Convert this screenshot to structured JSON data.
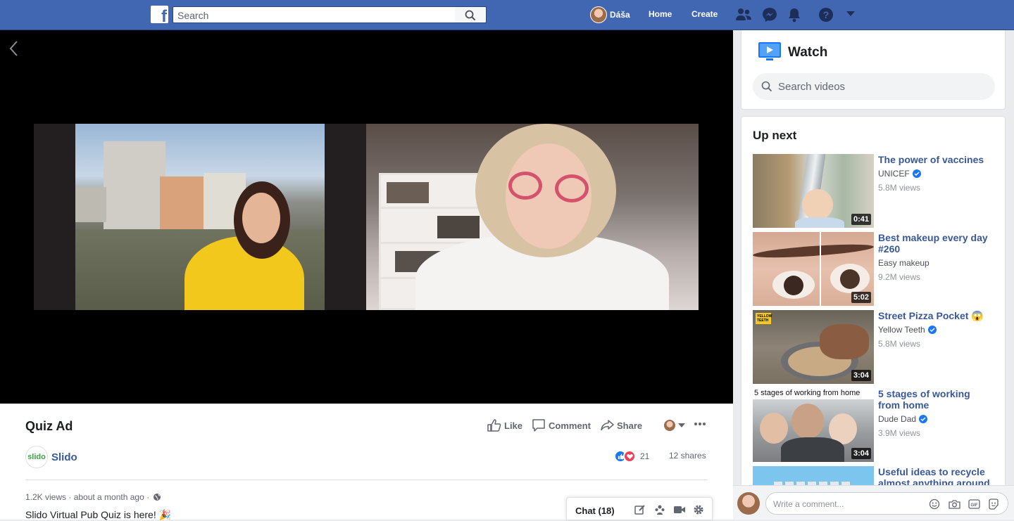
{
  "topbar": {
    "logo": "facebook-f",
    "search_placeholder": "Search",
    "user_name": "Dáša",
    "links": [
      "Home",
      "Create"
    ],
    "icons": [
      "friends-icon",
      "messenger-icon",
      "notifications-icon",
      "help-icon",
      "dropdown-icon"
    ]
  },
  "post": {
    "title": "Quiz Ad",
    "actions": {
      "like": "Like",
      "comment": "Comment",
      "share": "Share"
    },
    "page_logo_text": "slido",
    "page_name": "Slido",
    "reaction_count": "21",
    "shares": "12 shares",
    "meta": "1.2K views · about a month ago ·",
    "description": "Slido Virtual Pub Quiz is here! 🎉"
  },
  "chat": {
    "label": "Chat (18)"
  },
  "sidebar": {
    "watch_title": "Watch",
    "search_placeholder": "Search videos",
    "up_next_title": "Up next",
    "videos": [
      {
        "title": "The power of vaccines",
        "channel": "UNICEF",
        "verified": true,
        "views": "5.8M views",
        "duration": "0:41"
      },
      {
        "title": "Best makeup every day #260",
        "channel": "Easy makeup",
        "verified": false,
        "views": "9.2M views",
        "duration": "5:02"
      },
      {
        "title": "Street Pizza Pocket 😱",
        "channel": "Yellow Teeth",
        "verified": true,
        "views": "5.8M views",
        "duration": "3:04"
      },
      {
        "title": "5 stages of working from home",
        "channel": "Dude Dad",
        "verified": true,
        "views": "3.9M views",
        "duration": "3:04",
        "thumb_caption": "5 stages of working from home"
      },
      {
        "title": "Useful ideas to recycle almost anything around",
        "channel": "",
        "verified": false,
        "views": "",
        "duration": ""
      }
    ],
    "thumb_badge_3": "YELLOW TEETH"
  },
  "composer": {
    "placeholder": "Write a comment..."
  },
  "colors": {
    "brand": "#4267b2",
    "link": "#385898",
    "like": "#1877f2",
    "love": "#f33e58"
  }
}
